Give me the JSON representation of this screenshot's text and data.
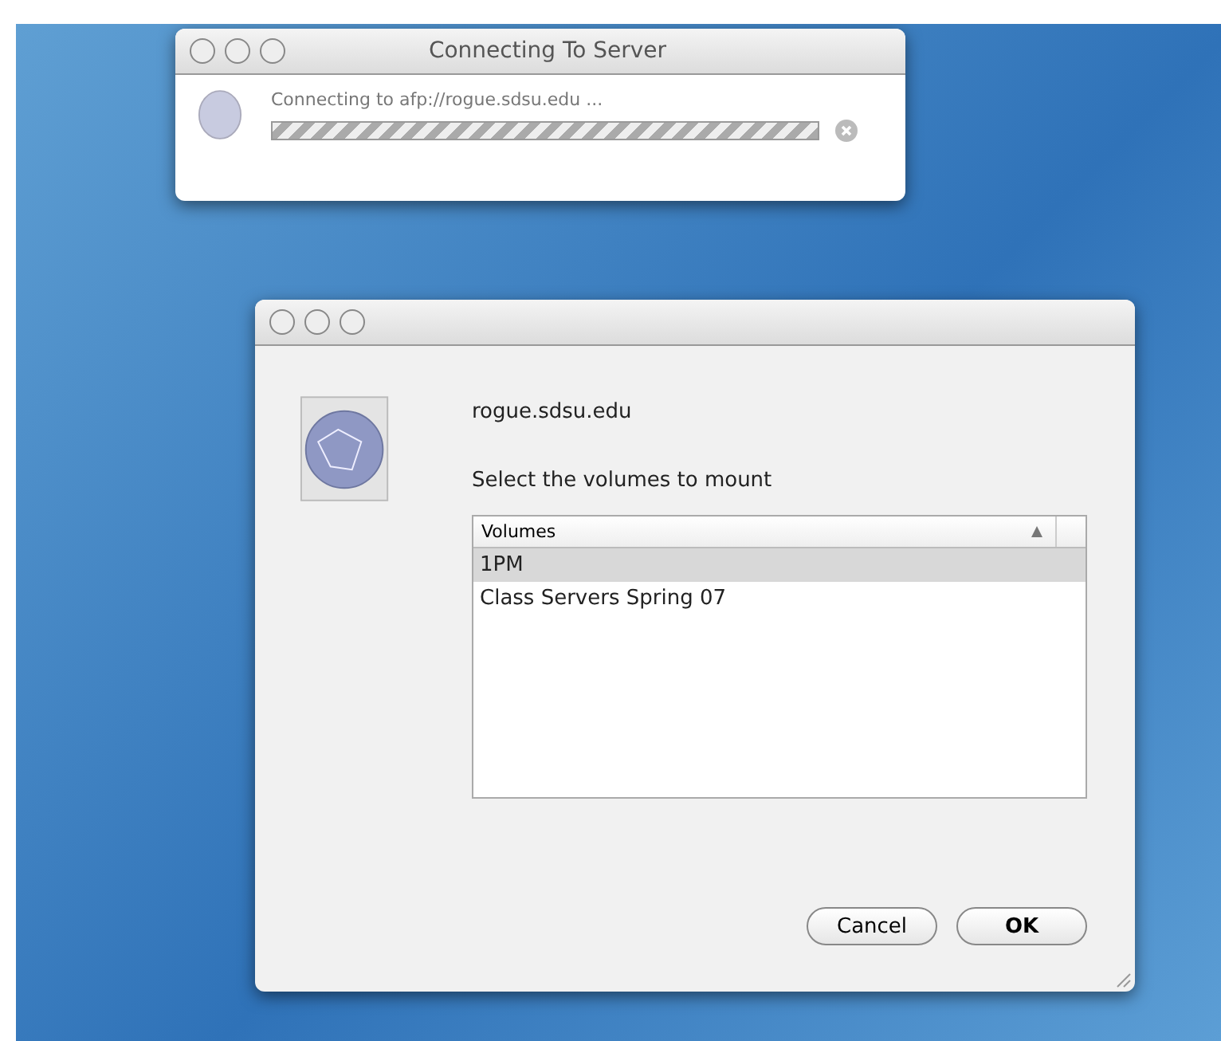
{
  "progress_window": {
    "title": "Connecting To Server",
    "message": "Connecting to afp://rogue.sdsu.edu ...",
    "indeterminate": true
  },
  "volume_dialog": {
    "server": "rogue.sdsu.edu",
    "prompt": "Select the volumes to mount",
    "table": {
      "columns": [
        {
          "label": "Volumes",
          "sorted_ascending": true
        }
      ],
      "rows": [
        {
          "name": "1PM",
          "selected": true
        },
        {
          "name": "Class Servers Spring 07",
          "selected": false
        }
      ]
    },
    "buttons": [
      {
        "label": "Cancel",
        "kind": "cancel"
      },
      {
        "label": "OK",
        "kind": "ok"
      }
    ]
  }
}
